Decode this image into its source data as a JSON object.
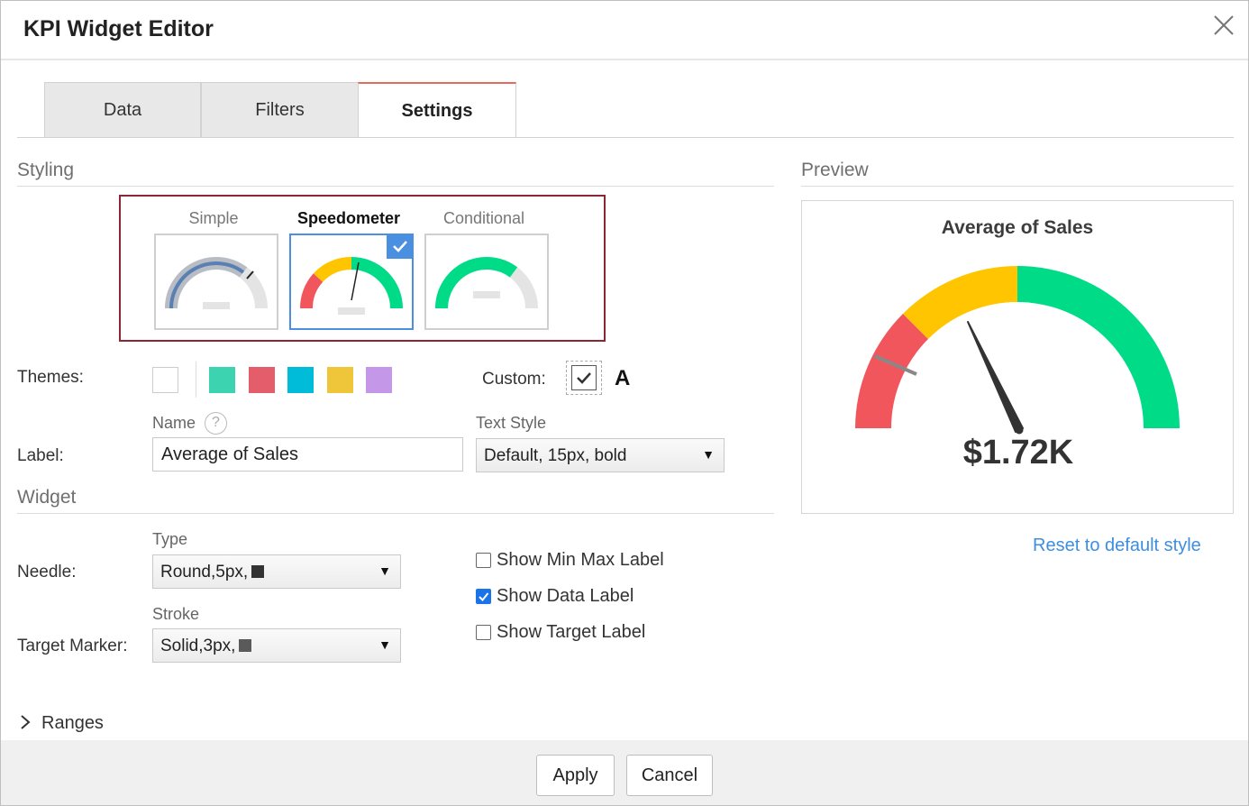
{
  "dialog": {
    "title": "KPI Widget Editor"
  },
  "tabs": [
    {
      "label": "Data"
    },
    {
      "label": "Filters"
    },
    {
      "label": "Settings",
      "active": true
    }
  ],
  "styling": {
    "section_title": "Styling",
    "options": [
      {
        "label": "Simple",
        "selected": false
      },
      {
        "label": "Speedometer",
        "selected": true
      },
      {
        "label": "Conditional",
        "selected": false
      }
    ]
  },
  "themes": {
    "label": "Themes:",
    "swatches": [
      "#ffffff",
      "#3cd3b0",
      "#e35d6a",
      "#00bcd9",
      "#efc53a",
      "#c597e8"
    ],
    "custom_label": "Custom:",
    "custom_checked": true,
    "font_icon": "A"
  },
  "label_section": {
    "name_label": "Name",
    "text_style_label": "Text Style",
    "row_label": "Label:",
    "name_value": "Average of Sales",
    "text_style_value": "Default, 15px, bold"
  },
  "widget": {
    "section_title": "Widget",
    "type_label": "Type",
    "needle_label": "Needle:",
    "needle_value": "Round,5px,",
    "stroke_label": "Stroke",
    "target_label": "Target Marker:",
    "target_value": "Solid,3px,",
    "options": [
      {
        "label": "Show Min Max Label",
        "checked": false
      },
      {
        "label": "Show Data Label",
        "checked": true
      },
      {
        "label": "Show Target Label",
        "checked": false
      }
    ]
  },
  "preview": {
    "section_title": "Preview",
    "title": "Average of Sales",
    "value_label": "$1.72K",
    "gauge_colors": [
      "#f2565d",
      "#fec500",
      "#00db88"
    ],
    "reset_link": "Reset to default style"
  },
  "ranges": {
    "label": "Ranges"
  },
  "footer": {
    "apply_label": "Apply",
    "cancel_label": "Cancel"
  }
}
